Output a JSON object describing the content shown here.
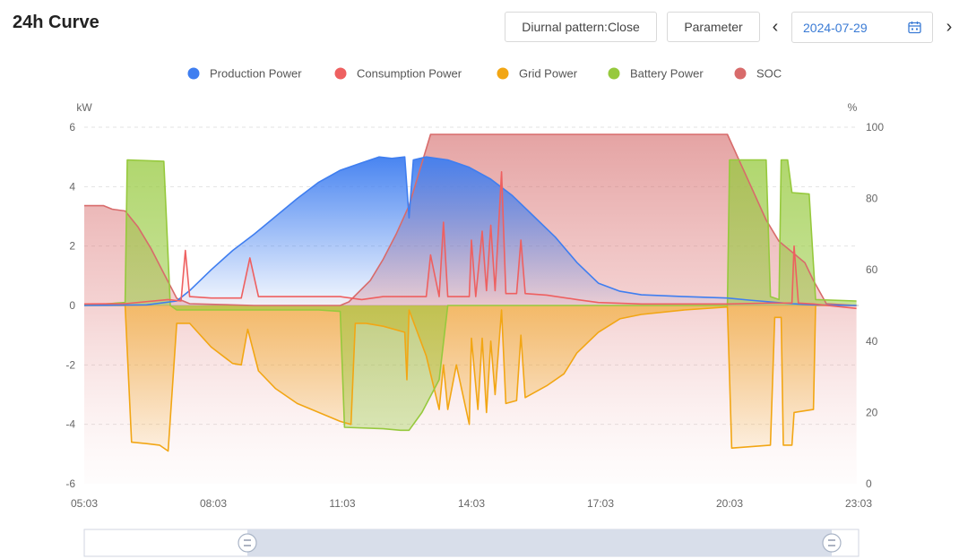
{
  "header": {
    "title": "24h Curve",
    "diurnal_label": "Diurnal pattern:Close",
    "parameter_label": "Parameter",
    "date": "2024-07-29",
    "prev_icon": "chevron-left-icon",
    "next_icon": "chevron-right-icon",
    "calendar_icon": "calendar-icon"
  },
  "chart_data": {
    "type": "line",
    "y_left_unit": "kW",
    "y_right_unit": "%",
    "ylim_left": [
      -6,
      6
    ],
    "ylim_right": [
      0,
      100
    ],
    "y_left_ticks": [
      "6",
      "4",
      "2",
      "0",
      "-2",
      "-4",
      "-6"
    ],
    "y_right_ticks": [
      "100",
      "80",
      "60",
      "40",
      "20",
      "0"
    ],
    "x_ticks": [
      "05:03",
      "08:03",
      "11:03",
      "14:03",
      "17:03",
      "20:03",
      "23:03"
    ],
    "grid": true,
    "legend_position": "top-center",
    "series": [
      {
        "name": "Production Power",
        "color": "#3f7ef0",
        "axis": "left",
        "points": [
          [
            5.05,
            0
          ],
          [
            6.5,
            0.02
          ],
          [
            7.2,
            0.15
          ],
          [
            7.5,
            0.5
          ],
          [
            8.0,
            1.2
          ],
          [
            8.5,
            1.85
          ],
          [
            9.0,
            2.4
          ],
          [
            9.5,
            3.0
          ],
          [
            10.0,
            3.6
          ],
          [
            10.5,
            4.15
          ],
          [
            11.0,
            4.55
          ],
          [
            11.5,
            4.8
          ],
          [
            11.9,
            5.0
          ],
          [
            12.2,
            4.95
          ],
          [
            12.5,
            5.0
          ],
          [
            12.6,
            2.95
          ],
          [
            12.7,
            4.9
          ],
          [
            13.0,
            5.0
          ],
          [
            13.5,
            4.9
          ],
          [
            14.0,
            4.65
          ],
          [
            14.5,
            4.25
          ],
          [
            15.0,
            3.7
          ],
          [
            15.5,
            3.0
          ],
          [
            16.0,
            2.3
          ],
          [
            16.5,
            1.45
          ],
          [
            17.0,
            0.75
          ],
          [
            17.5,
            0.48
          ],
          [
            18.0,
            0.36
          ],
          [
            19.0,
            0.3
          ],
          [
            20.0,
            0.25
          ],
          [
            20.5,
            0.18
          ],
          [
            21.0,
            0.12
          ],
          [
            21.5,
            0.06
          ],
          [
            22.0,
            0.02
          ],
          [
            23.0,
            0
          ]
        ]
      },
      {
        "name": "Consumption Power",
        "color": "#ee6060",
        "axis": "left",
        "points": [
          [
            5.05,
            0.05
          ],
          [
            6.0,
            0.06
          ],
          [
            7.0,
            0.2
          ],
          [
            7.3,
            0.15
          ],
          [
            7.4,
            1.85
          ],
          [
            7.5,
            0.3
          ],
          [
            8.0,
            0.25
          ],
          [
            8.7,
            0.25
          ],
          [
            8.9,
            1.6
          ],
          [
            9.1,
            0.3
          ],
          [
            10.0,
            0.3
          ],
          [
            11.0,
            0.3
          ],
          [
            11.5,
            0.2
          ],
          [
            12.0,
            0.3
          ],
          [
            12.7,
            0.3
          ],
          [
            13.0,
            0.3
          ],
          [
            13.1,
            1.7
          ],
          [
            13.3,
            0.3
          ],
          [
            13.4,
            2.8
          ],
          [
            13.5,
            0.3
          ],
          [
            14.0,
            0.3
          ],
          [
            14.05,
            2.2
          ],
          [
            14.15,
            0.3
          ],
          [
            14.3,
            2.5
          ],
          [
            14.4,
            0.5
          ],
          [
            14.5,
            2.7
          ],
          [
            14.6,
            0.5
          ],
          [
            14.75,
            4.5
          ],
          [
            14.85,
            0.4
          ],
          [
            15.1,
            0.4
          ],
          [
            15.2,
            2.2
          ],
          [
            15.3,
            0.4
          ],
          [
            15.8,
            0.35
          ],
          [
            16.5,
            0.2
          ],
          [
            17.0,
            0.1
          ],
          [
            18.0,
            0.05
          ],
          [
            20.0,
            0.05
          ],
          [
            21.0,
            0.08
          ],
          [
            21.5,
            0.08
          ],
          [
            21.55,
            2.0
          ],
          [
            21.65,
            0.08
          ],
          [
            22.0,
            0.05
          ],
          [
            23.0,
            -0.1
          ]
        ]
      },
      {
        "name": "Grid Power",
        "color": "#f2a614",
        "axis": "left",
        "points": [
          [
            5.05,
            0
          ],
          [
            6.0,
            0
          ],
          [
            6.15,
            -4.6
          ],
          [
            6.5,
            -4.65
          ],
          [
            6.8,
            -4.7
          ],
          [
            7.0,
            -4.9
          ],
          [
            7.2,
            -0.6
          ],
          [
            7.3,
            -0.6
          ],
          [
            7.5,
            -0.6
          ],
          [
            8.0,
            -1.4
          ],
          [
            8.5,
            -1.95
          ],
          [
            8.7,
            -2.0
          ],
          [
            8.85,
            -0.8
          ],
          [
            9.1,
            -2.2
          ],
          [
            9.5,
            -2.8
          ],
          [
            10.0,
            -3.3
          ],
          [
            10.5,
            -3.6
          ],
          [
            11.0,
            -3.9
          ],
          [
            11.25,
            -4.0
          ],
          [
            11.35,
            -0.6
          ],
          [
            11.6,
            -0.6
          ],
          [
            12.0,
            -0.7
          ],
          [
            12.5,
            -0.9
          ],
          [
            12.55,
            -2.5
          ],
          [
            12.6,
            -0.15
          ],
          [
            13.0,
            -1.7
          ],
          [
            13.3,
            -3.5
          ],
          [
            13.4,
            -2.0
          ],
          [
            13.5,
            -3.5
          ],
          [
            13.7,
            -2.0
          ],
          [
            14.0,
            -4.0
          ],
          [
            14.05,
            -1.1
          ],
          [
            14.2,
            -3.5
          ],
          [
            14.3,
            -1.1
          ],
          [
            14.4,
            -3.6
          ],
          [
            14.5,
            -1.2
          ],
          [
            14.6,
            -3.0
          ],
          [
            14.75,
            -0.15
          ],
          [
            14.85,
            -3.3
          ],
          [
            15.1,
            -3.2
          ],
          [
            15.2,
            -1.0
          ],
          [
            15.3,
            -3.1
          ],
          [
            15.8,
            -2.7
          ],
          [
            16.2,
            -2.3
          ],
          [
            16.5,
            -1.6
          ],
          [
            17.0,
            -0.9
          ],
          [
            17.5,
            -0.45
          ],
          [
            18.0,
            -0.3
          ],
          [
            19.0,
            -0.15
          ],
          [
            20.0,
            -0.05
          ],
          [
            20.1,
            -4.8
          ],
          [
            21.0,
            -4.7
          ],
          [
            21.1,
            -0.4
          ],
          [
            21.25,
            -0.4
          ],
          [
            21.3,
            -4.7
          ],
          [
            21.5,
            -4.7
          ],
          [
            21.55,
            -3.6
          ],
          [
            22.0,
            -3.5
          ],
          [
            22.05,
            0
          ],
          [
            23.0,
            0
          ]
        ]
      },
      {
        "name": "Battery Power",
        "color": "#96c93d",
        "axis": "left",
        "points": [
          [
            5.05,
            0
          ],
          [
            6.0,
            0.1
          ],
          [
            6.05,
            4.9
          ],
          [
            6.9,
            4.85
          ],
          [
            7.05,
            0.0
          ],
          [
            7.2,
            -0.15
          ],
          [
            9.0,
            -0.15
          ],
          [
            10.5,
            -0.15
          ],
          [
            11.0,
            -0.2
          ],
          [
            11.1,
            -4.1
          ],
          [
            12.0,
            -4.15
          ],
          [
            12.4,
            -4.2
          ],
          [
            12.6,
            -4.2
          ],
          [
            12.9,
            -3.6
          ],
          [
            13.3,
            -2.5
          ],
          [
            13.5,
            0.0
          ],
          [
            14.0,
            0
          ],
          [
            20.0,
            0
          ],
          [
            20.05,
            4.9
          ],
          [
            20.9,
            4.9
          ],
          [
            21.0,
            0.3
          ],
          [
            21.2,
            0.2
          ],
          [
            21.25,
            4.9
          ],
          [
            21.4,
            4.9
          ],
          [
            21.5,
            3.8
          ],
          [
            21.9,
            3.75
          ],
          [
            22.05,
            0.2
          ],
          [
            23.0,
            0.15
          ]
        ]
      },
      {
        "name": "SOC",
        "color": "#d86b6b",
        "axis": "right",
        "points": [
          [
            5.05,
            78
          ],
          [
            5.5,
            78
          ],
          [
            5.7,
            77
          ],
          [
            6.0,
            76.5
          ],
          [
            6.3,
            72
          ],
          [
            6.6,
            66
          ],
          [
            6.9,
            59
          ],
          [
            7.2,
            52
          ],
          [
            7.5,
            50.5
          ],
          [
            9.0,
            50
          ],
          [
            10.0,
            50
          ],
          [
            11.0,
            50
          ],
          [
            11.2,
            51
          ],
          [
            11.7,
            57
          ],
          [
            12.0,
            63
          ],
          [
            12.3,
            70
          ],
          [
            12.6,
            78
          ],
          [
            12.9,
            90
          ],
          [
            13.1,
            98
          ],
          [
            14.0,
            98
          ],
          [
            16.0,
            98
          ],
          [
            18.0,
            98
          ],
          [
            19.0,
            98
          ],
          [
            20.0,
            98
          ],
          [
            20.3,
            90
          ],
          [
            20.6,
            82
          ],
          [
            20.9,
            74
          ],
          [
            21.2,
            68
          ],
          [
            21.4,
            66
          ],
          [
            21.8,
            62
          ],
          [
            22.0,
            57
          ],
          [
            22.3,
            50.5
          ],
          [
            23.0,
            50
          ]
        ]
      }
    ]
  },
  "zoom_slider": {
    "left_handle_icon": "slider-handle-icon",
    "right_handle_icon": "slider-handle-icon"
  }
}
